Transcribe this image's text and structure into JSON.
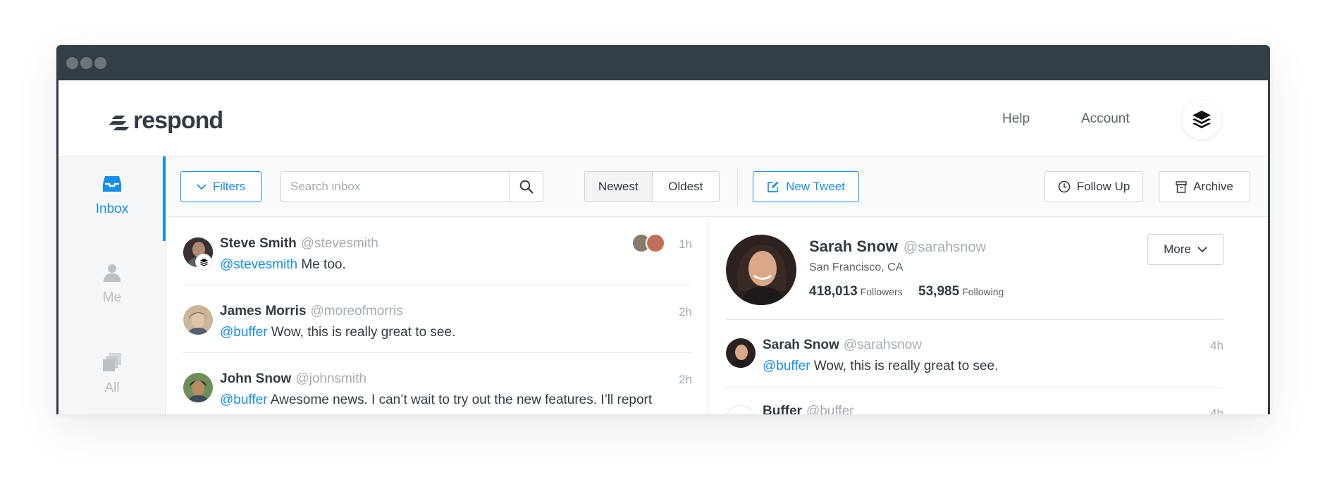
{
  "header": {
    "logo_text": "respond",
    "nav": {
      "help": "Help",
      "account": "Account"
    }
  },
  "sidebar": {
    "items": [
      {
        "label": "Inbox",
        "icon": "inbox-icon",
        "active": true
      },
      {
        "label": "Me",
        "icon": "person-icon",
        "active": false
      },
      {
        "label": "All",
        "icon": "stack-icon",
        "active": false
      }
    ]
  },
  "toolbar": {
    "filters_label": "Filters",
    "search_placeholder": "Search inbox",
    "sort_newest": "Newest",
    "sort_oldest": "Oldest",
    "new_tweet_label": "New Tweet",
    "follow_up_label": "Follow Up",
    "archive_label": "Archive"
  },
  "conversations": [
    {
      "name": "Steve Smith",
      "handle": "@stevesmith",
      "mention": "@stevesmith",
      "text": " Me too.",
      "time": "1h"
    },
    {
      "name": "James Morris",
      "handle": "@moreofmorris",
      "mention": "@buffer",
      "text": " Wow, this is really great to see.",
      "time": "2h"
    },
    {
      "name": "John Snow",
      "handle": "@johnsmith",
      "mention": "@buffer",
      "text": " Awesome news. I can’t wait to try out the new features. I’ll report",
      "time": "2h"
    }
  ],
  "profile": {
    "name": "Sarah Snow",
    "handle": "@sarahsnow",
    "location": "San Francisco, CA",
    "followers_count": "418,013",
    "followers_label": "Followers",
    "following_count": "53,985",
    "following_label": "Following",
    "more_label": "More"
  },
  "thread": [
    {
      "name": "Sarah Snow",
      "handle": "@sarahsnow",
      "mention": "@buffer",
      "text": " Wow, this is really great to see.",
      "time": "4h"
    },
    {
      "name": "Buffer",
      "handle": "@buffer",
      "time": "4h"
    }
  ],
  "colors": {
    "accent": "#168eea",
    "titlebar": "#343e47",
    "muted": "#a4acb3"
  }
}
